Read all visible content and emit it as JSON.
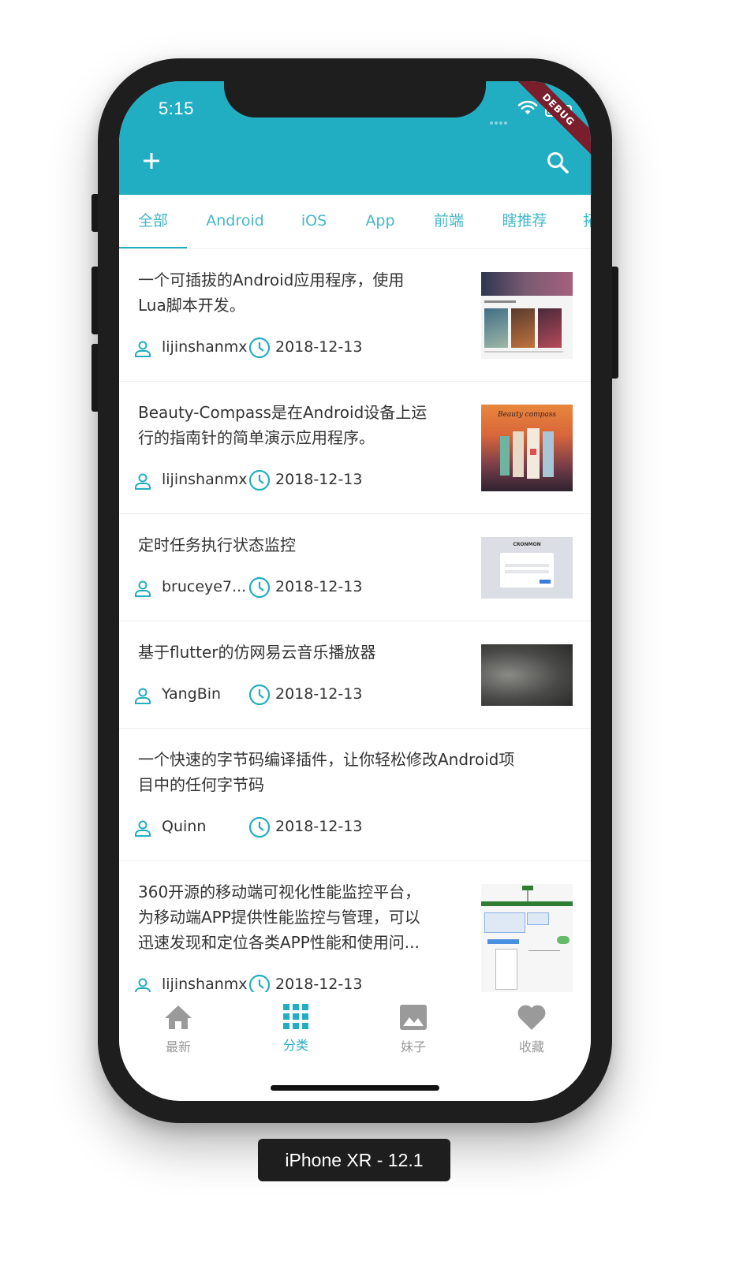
{
  "status_bar": {
    "time": "5:15",
    "debug_label": "DEBUG"
  },
  "app_bar": {
    "add_icon": "plus-icon",
    "search_icon": "search-icon"
  },
  "tabs": [
    {
      "label": "全部",
      "selected": true
    },
    {
      "label": "Android",
      "selected": false
    },
    {
      "label": "iOS",
      "selected": false
    },
    {
      "label": "App",
      "selected": false
    },
    {
      "label": "前端",
      "selected": false
    },
    {
      "label": "瞎推荐",
      "selected": false
    },
    {
      "label": "拓",
      "selected": false
    }
  ],
  "articles": [
    {
      "title_lines": [
        "一个可插拔的Android应用程序，使用",
        "Lua脚本开发。"
      ],
      "author": "lijinshanmx",
      "date": "2018-12-13",
      "has_thumbnail": true
    },
    {
      "title_lines": [
        "Beauty-Compass是在Android设备上运",
        "行的指南针的简单演示应用程序。"
      ],
      "author": "lijinshanmx",
      "date": "2018-12-13",
      "has_thumbnail": true,
      "thumbnail_text": "Beauty compass"
    },
    {
      "title_lines": [
        "定时任务执行状态监控"
      ],
      "author": "bruceye7...",
      "date": "2018-12-13",
      "has_thumbnail": true,
      "thumbnail_text": "CRONMON"
    },
    {
      "title_lines": [
        "基于flutter的仿网易云音乐播放器"
      ],
      "author": "YangBin",
      "date": "2018-12-13",
      "has_thumbnail": true
    },
    {
      "title_lines": [
        "一个快速的字节码编译插件，让你轻松修改Android项",
        "目中的任何字节码"
      ],
      "author": "Quinn",
      "date": "2018-12-13",
      "has_thumbnail": false
    },
    {
      "title_lines": [
        "360开源的移动端可视化性能监控平台，",
        "为移动端APP提供性能监控与管理，可以",
        "迅速发现和定位各类APP性能和使用问..."
      ],
      "author": "lijinshanmx",
      "date": "2018-12-13",
      "has_thumbnail": true
    }
  ],
  "bottom_nav": [
    {
      "label": "最新",
      "icon": "home-icon",
      "active": false
    },
    {
      "label": "分类",
      "icon": "grid-icon",
      "active": true
    },
    {
      "label": "妹子",
      "icon": "image-icon",
      "active": false
    },
    {
      "label": "收藏",
      "icon": "heart-icon",
      "active": false
    }
  ],
  "colors": {
    "primary": "#22aec2",
    "tab_text": "#45b8c7",
    "nav_inactive": "#9a9a9a",
    "debug": "#7a1e2b"
  },
  "device_label": "iPhone XR - 12.1"
}
